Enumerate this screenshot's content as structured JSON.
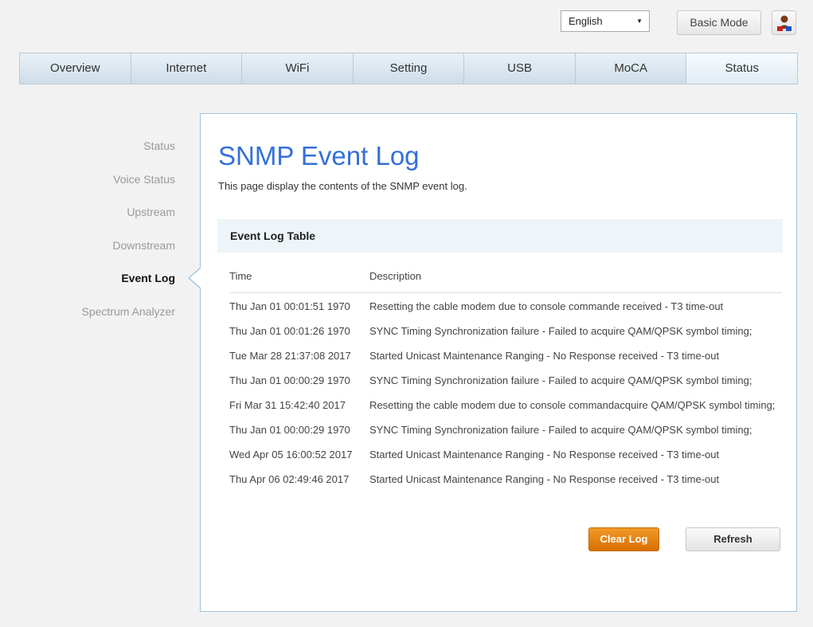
{
  "header": {
    "language": "English",
    "basic_mode_label": "Basic Mode"
  },
  "nav": {
    "tabs": [
      {
        "label": "Overview"
      },
      {
        "label": "Internet"
      },
      {
        "label": "WiFi"
      },
      {
        "label": "Setting"
      },
      {
        "label": "USB"
      },
      {
        "label": "MoCA"
      },
      {
        "label": "Status"
      }
    ],
    "active_tab": "Status"
  },
  "sidebar": {
    "items": [
      {
        "label": "Status"
      },
      {
        "label": "Voice Status"
      },
      {
        "label": "Upstream"
      },
      {
        "label": "Downstream"
      },
      {
        "label": "Event Log"
      },
      {
        "label": "Spectrum Analyzer"
      }
    ],
    "active_item": "Event Log"
  },
  "main": {
    "title": "SNMP Event Log",
    "description": "This page display the contents of the SNMP event log.",
    "table_title": "Event Log Table",
    "columns": [
      "Time",
      "Description"
    ],
    "rows": [
      {
        "time": "Thu Jan 01 00:01:51 1970",
        "description": "Resetting the cable modem due to console commande received - T3 time-out"
      },
      {
        "time": "Thu Jan 01 00:01:26 1970",
        "description": "SYNC Timing Synchronization failure - Failed to acquire QAM/QPSK symbol timing;"
      },
      {
        "time": "Tue Mar 28 21:37:08 2017",
        "description": "Started Unicast Maintenance Ranging - No Response received - T3 time-out"
      },
      {
        "time": "Thu Jan 01 00:00:29 1970",
        "description": "SYNC Timing Synchronization failure - Failed to acquire QAM/QPSK symbol timing;"
      },
      {
        "time": "Fri Mar 31 15:42:40 2017",
        "description": "Resetting the cable modem due to console commandacquire QAM/QPSK symbol timing;"
      },
      {
        "time": "Thu Jan 01 00:00:29 1970",
        "description": "SYNC Timing Synchronization failure - Failed to acquire QAM/QPSK symbol timing;"
      },
      {
        "time": "Wed Apr 05 16:00:52 2017",
        "description": "Started Unicast Maintenance Ranging - No Response received - T3 time-out"
      },
      {
        "time": "Thu Apr 06 02:49:46 2017",
        "description": "Started Unicast Maintenance Ranging - No Response received - T3 time-out"
      }
    ],
    "clear_label": "Clear Log",
    "refresh_label": "Refresh"
  },
  "colors": {
    "title": "#3470d8",
    "primary_button": "#e07800",
    "nav_bg": "#d9e6ef"
  },
  "icons": {
    "select_arrow": "chevron-down-icon",
    "user": "user-icon"
  }
}
